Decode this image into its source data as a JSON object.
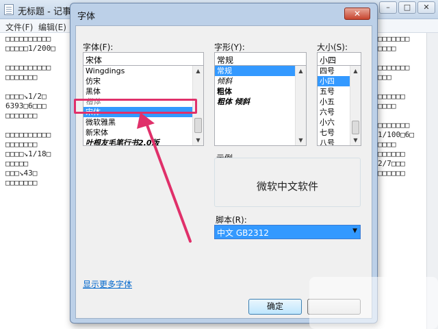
{
  "notepad": {
    "title": "无标题 - 记事本",
    "menu": [
      "文件(F)",
      "编辑(E)"
    ],
    "text_lines": [
      "□□□□□□□□□□",
      "□□□□□1/200□",
      "",
      "□□□□□□□□□□",
      "□□□□□□□",
      "",
      "□□□□↘1/2□",
      "6393□6□□□",
      "□□□□□□□",
      "",
      "□□□□□□□□□□",
      "□□□□□□□",
      "□□□□↘1/18□",
      "□□□□□",
      "□□□↘43□",
      "□□□□□□□"
    ],
    "right_lines": [
      "□□□□□□□",
      "□□□□",
      "",
      "□□□□□□□",
      "□□□",
      "",
      "□□□□□□",
      "□□□□",
      "",
      "□□□□□□□",
      "1/100□6□",
      "□□□□",
      "□□□□□□",
      "2/7□□□",
      "□□□□□□"
    ],
    "window_buttons": [
      "–",
      "□",
      "✕"
    ]
  },
  "dialog": {
    "title": "字体",
    "close": "✕",
    "font_label": "字体(F):",
    "font_value": "宋体",
    "font_list": [
      "Wingdings",
      "仿宋",
      "黑体",
      "楷体",
      "宋体",
      "微软雅黑",
      "新宋体",
      "叶根友毛笔行书2.0版"
    ],
    "font_selected_index": 4,
    "style_label": "字形(Y):",
    "style_value": "常规",
    "style_list": [
      "常规",
      "倾斜",
      "粗体",
      "粗体 倾斜"
    ],
    "style_selected_index": 0,
    "size_label": "大小(S):",
    "size_value": "小四",
    "size_list": [
      "四号",
      "小四",
      "五号",
      "小五",
      "六号",
      "小六",
      "七号",
      "八号"
    ],
    "size_selected_index": 1,
    "sample_label": "示例",
    "sample_text": "微软中文软件",
    "script_label": "脚本(R):",
    "script_value": "中文 GB2312",
    "more_fonts_link": "显示更多字体",
    "ok_button": "确定"
  },
  "annotation": {
    "highlight_color": "#e0306a"
  }
}
